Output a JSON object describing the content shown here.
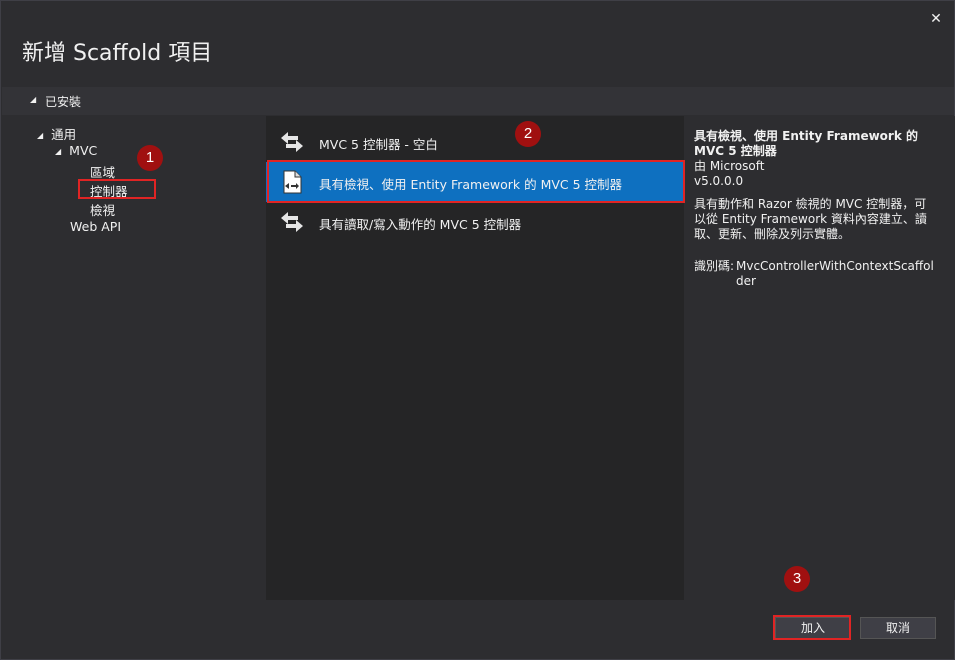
{
  "dialog": {
    "title": "新增 Scaffold 項目",
    "close_glyph": "✕"
  },
  "installed": {
    "label": "已安裝"
  },
  "tree": {
    "common": "通用",
    "mvc": "MVC",
    "area": "區域",
    "controller": "控制器",
    "view": "檢視",
    "webapi": "Web API"
  },
  "templates": [
    {
      "label": "MVC 5 控制器 - 空白",
      "icon": "controller-arrows-icon"
    },
    {
      "label": "具有檢視、使用 Entity Framework 的 MVC 5 控制器",
      "icon": "controller-document-icon"
    },
    {
      "label": "具有讀取/寫入動作的 MVC 5 控制器",
      "icon": "controller-arrows-icon"
    }
  ],
  "details": {
    "title_line1": "具有檢視、使用 Entity Framework 的",
    "title_line2": "MVC 5 控制器",
    "by": "由 Microsoft",
    "version": "v5.0.0.0",
    "desc_line1": "具有動作和 Razor 檢視的 MVC 控制器，可",
    "desc_line2": "以從 Entity Framework 資料內容建立、讀",
    "desc_line3": "取、更新、刪除及列示實體。",
    "id_label": "識別碼:",
    "id_value_line1": "MvcControllerWithContextScaffol",
    "id_value_line2": "der"
  },
  "buttons": {
    "add": "加入",
    "cancel": "取消"
  },
  "badges": {
    "b1": "1",
    "b2": "2",
    "b3": "3"
  },
  "colors": {
    "selected_bg": "#0e70c0",
    "highlight_red": "#e02424",
    "badge_bg": "#a01010"
  }
}
